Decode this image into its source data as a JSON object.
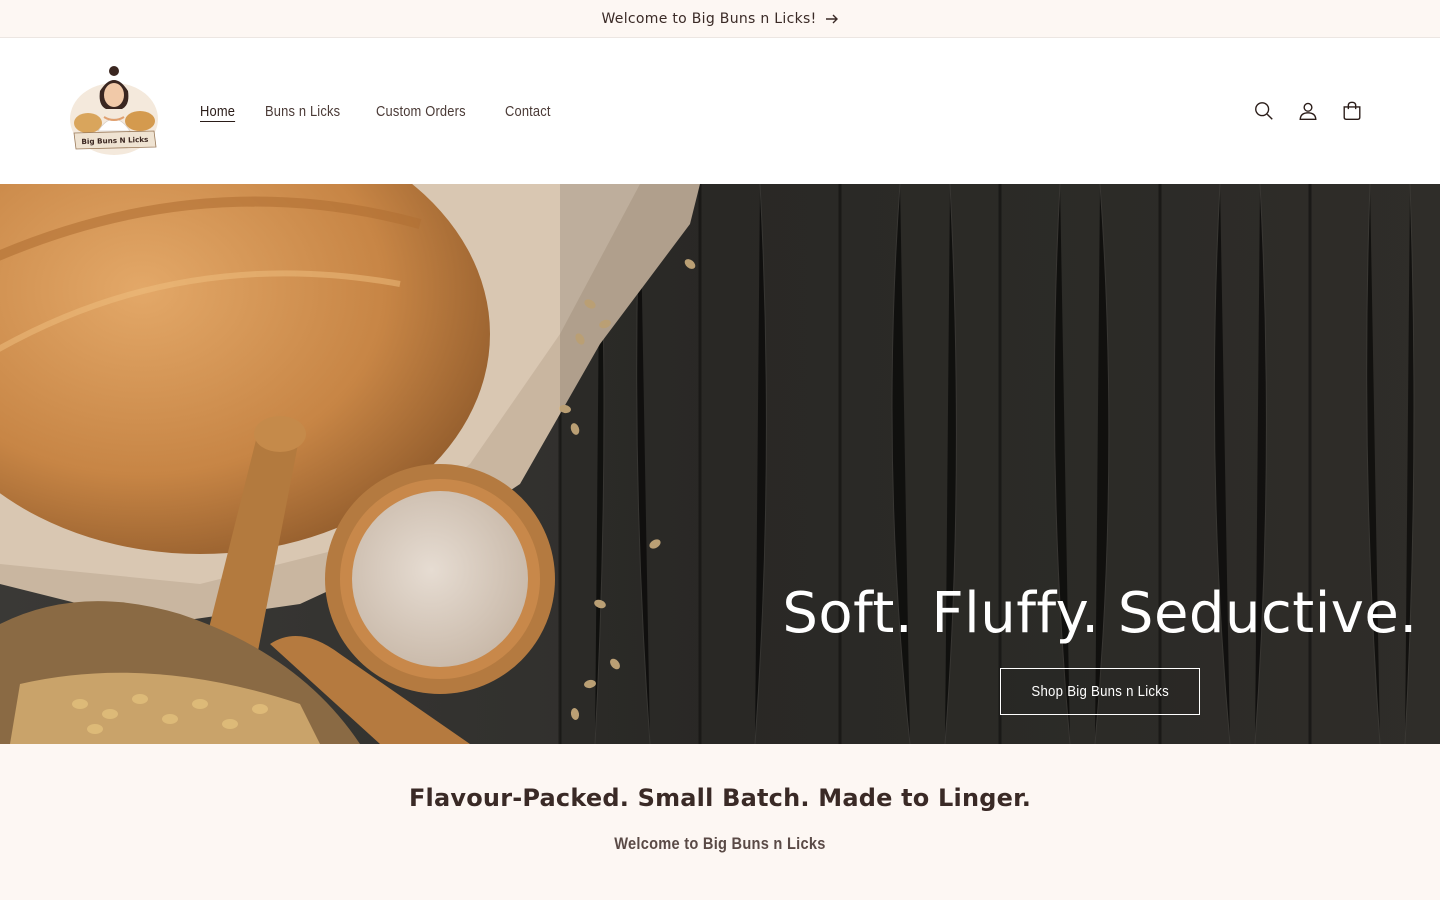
{
  "announcement": {
    "text": "Welcome to Big Buns n Licks!",
    "icon": "arrow-right-icon"
  },
  "header": {
    "logo": {
      "text": "Big Buns N Licks"
    },
    "nav": [
      {
        "label": "Home",
        "active": true
      },
      {
        "label": "Buns n Licks",
        "active": false
      },
      {
        "label": "Custom Orders",
        "active": false
      },
      {
        "label": "Contact",
        "active": false
      }
    ],
    "icons": [
      "search-icon",
      "account-icon",
      "cart-icon"
    ]
  },
  "hero": {
    "title": "Soft. Fluffy. Seductive.",
    "button_label": "Shop Big Buns n Licks"
  },
  "intro": {
    "heading": "Flavour-Packed. Small Batch. Made to Linger.",
    "subheading": "Welcome to Big Buns n Licks"
  },
  "colors": {
    "background_cream": "#fdf7f3",
    "text_dark": "#3a2a26",
    "hero_wood": "#2b2a28"
  }
}
